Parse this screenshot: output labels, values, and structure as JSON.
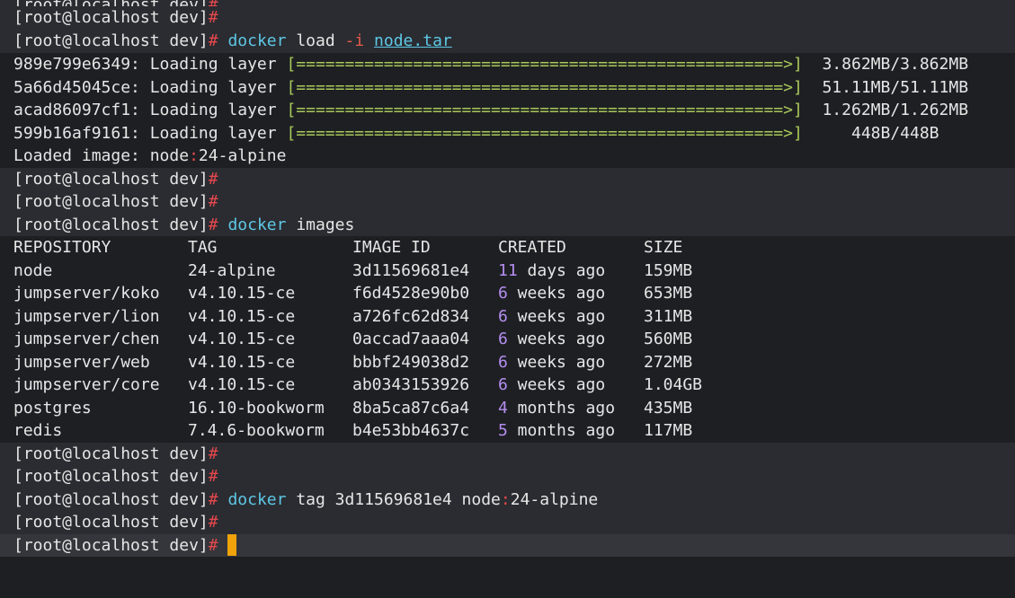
{
  "prompt": {
    "user_host": "[root@localhost dev]",
    "hash": "#"
  },
  "commands": {
    "load": {
      "cmd": "docker",
      "sub": "load",
      "flag": "-i",
      "file": "node.tar"
    },
    "images": {
      "cmd": "docker",
      "sub": "images"
    },
    "tag": {
      "cmd": "docker",
      "sub": "tag 3d11569681e4 node",
      "colon": ":",
      "ref": "24-alpine"
    }
  },
  "loading_layers": [
    {
      "id": "989e799e6349",
      "label": ": Loading layer ",
      "bar": "[==================================================>]",
      "size": "  3.862MB/3.862MB"
    },
    {
      "id": "5a66d45045ce",
      "label": ": Loading layer ",
      "bar": "[==================================================>]",
      "size": "  51.11MB/51.11MB"
    },
    {
      "id": "acad86097cf1",
      "label": ": Loading layer ",
      "bar": "[==================================================>]",
      "size": "  1.262MB/1.262MB"
    },
    {
      "id": "599b16af9161",
      "label": ": Loading layer ",
      "bar": "[==================================================>]",
      "size": "     448B/448B"
    }
  ],
  "loaded_image": {
    "prefix": "Loaded image: node",
    "colon": ":",
    "ref": "24-alpine"
  },
  "images_table": {
    "headers": [
      "REPOSITORY",
      "TAG",
      "IMAGE ID",
      "CREATED",
      "SIZE"
    ],
    "rows": [
      {
        "repo": "node",
        "tag": "24-alpine",
        "id": "3d11569681e4",
        "num": "11",
        "ago": " days ago",
        "size": "159MB"
      },
      {
        "repo": "jumpserver/koko",
        "tag": "v4.10.15-ce",
        "id": "f6d4528e90b0",
        "num": "6",
        "ago": " weeks ago",
        "size": "653MB"
      },
      {
        "repo": "jumpserver/lion",
        "tag": "v4.10.15-ce",
        "id": "a726fc62d834",
        "num": "6",
        "ago": " weeks ago",
        "size": "311MB"
      },
      {
        "repo": "jumpserver/chen",
        "tag": "v4.10.15-ce",
        "id": "0accad7aaa04",
        "num": "6",
        "ago": " weeks ago",
        "size": "560MB"
      },
      {
        "repo": "jumpserver/web",
        "tag": "v4.10.15-ce",
        "id": "bbbf249038d2",
        "num": "6",
        "ago": " weeks ago",
        "size": "272MB"
      },
      {
        "repo": "jumpserver/core",
        "tag": "v4.10.15-ce",
        "id": "ab0343153926",
        "num": "6",
        "ago": " weeks ago",
        "size": "1.04GB"
      },
      {
        "repo": "postgres",
        "tag": "16.10-bookworm",
        "id": "8ba5ca87c6a4",
        "num": "4",
        "ago": " months ago",
        "size": "435MB"
      },
      {
        "repo": "redis",
        "tag": "7.4.6-bookworm",
        "id": "b4e53bb4637c",
        "num": "5",
        "ago": " months ago",
        "size": "117MB"
      }
    ]
  },
  "colors": {
    "background": "#1e1f23",
    "hash": "#e5484d",
    "command": "#5ec7e6",
    "progress_bar": "#a8c85a",
    "number": "#b48ef0",
    "cursor": "#f0a30a"
  }
}
